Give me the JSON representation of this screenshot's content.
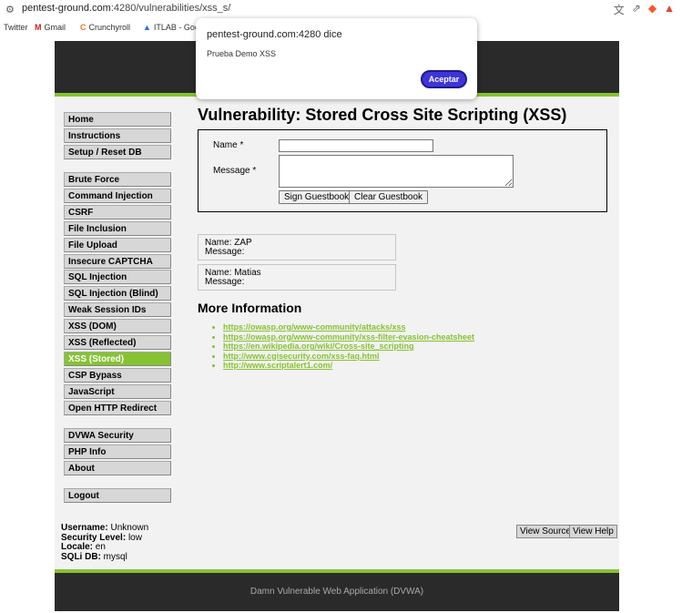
{
  "browser": {
    "url_host": "pentest-ground.com",
    "url_rest": ":4280/vulnerabilities/xss_s/",
    "icons": [
      "translate-icon",
      "share-icon",
      "brave-icon",
      "brave-rewards-icon"
    ]
  },
  "bookmarks": [
    {
      "label": "Twitter",
      "icon": ""
    },
    {
      "label": "Gmail",
      "icon": "M"
    },
    {
      "label": "Crunchyroll",
      "icon": "C"
    },
    {
      "label": "ITLAB - Goc",
      "icon": "▲"
    }
  ],
  "menu": {
    "group1": [
      "Home",
      "Instructions",
      "Setup / Reset DB"
    ],
    "group2": [
      "Brute Force",
      "Command Injection",
      "CSRF",
      "File Inclusion",
      "File Upload",
      "Insecure CAPTCHA",
      "SQL Injection",
      "SQL Injection (Blind)",
      "Weak Session IDs",
      "XSS (DOM)",
      "XSS (Reflected)",
      "XSS (Stored)",
      "CSP Bypass",
      "JavaScript",
      "Open HTTP Redirect"
    ],
    "group3": [
      "DVWA Security",
      "PHP Info",
      "About"
    ],
    "group4": [
      "Logout"
    ],
    "active": "XSS (Stored)"
  },
  "main": {
    "title": "Vulnerability: Stored Cross Site Scripting (XSS)",
    "form": {
      "name_label": "Name *",
      "message_label": "Message *",
      "name_value": "",
      "message_value": "",
      "sign_button": "Sign Guestbook",
      "clear_button": "Clear Guestbook"
    },
    "entries": [
      {
        "name": "Name: ZAP",
        "message": "Message:"
      },
      {
        "name": "Name: Matias",
        "message": "Message:"
      }
    ],
    "more_title": "More Information",
    "links": [
      "https://owasp.org/www-community/attacks/xss",
      "https://owasp.org/www-community/xss-filter-evasion-cheatsheet",
      "https://en.wikipedia.org/wiki/Cross-site_scripting",
      "http://www.cgisecurity.com/xss-faq.html",
      "http://www.scriptalert1.com/"
    ]
  },
  "status": {
    "username_label": "Username:",
    "username": "Unknown",
    "security_label": "Security Level:",
    "security": "low",
    "locale_label": "Locale:",
    "locale": "en",
    "sqli_label": "SQLi DB:",
    "sqli": "mysql"
  },
  "view_source": "View Source",
  "view_help": "View Help",
  "footer": "Damn Vulnerable Web Application (DVWA)",
  "dialog": {
    "title": "pentest-ground.com:4280 dice",
    "message": "Prueba Demo XSS",
    "ok": "Aceptar"
  },
  "colors": {
    "accent_green": "#86c232",
    "header_dark": "#2a2a2a",
    "dialog_button": "#3d35d8"
  }
}
